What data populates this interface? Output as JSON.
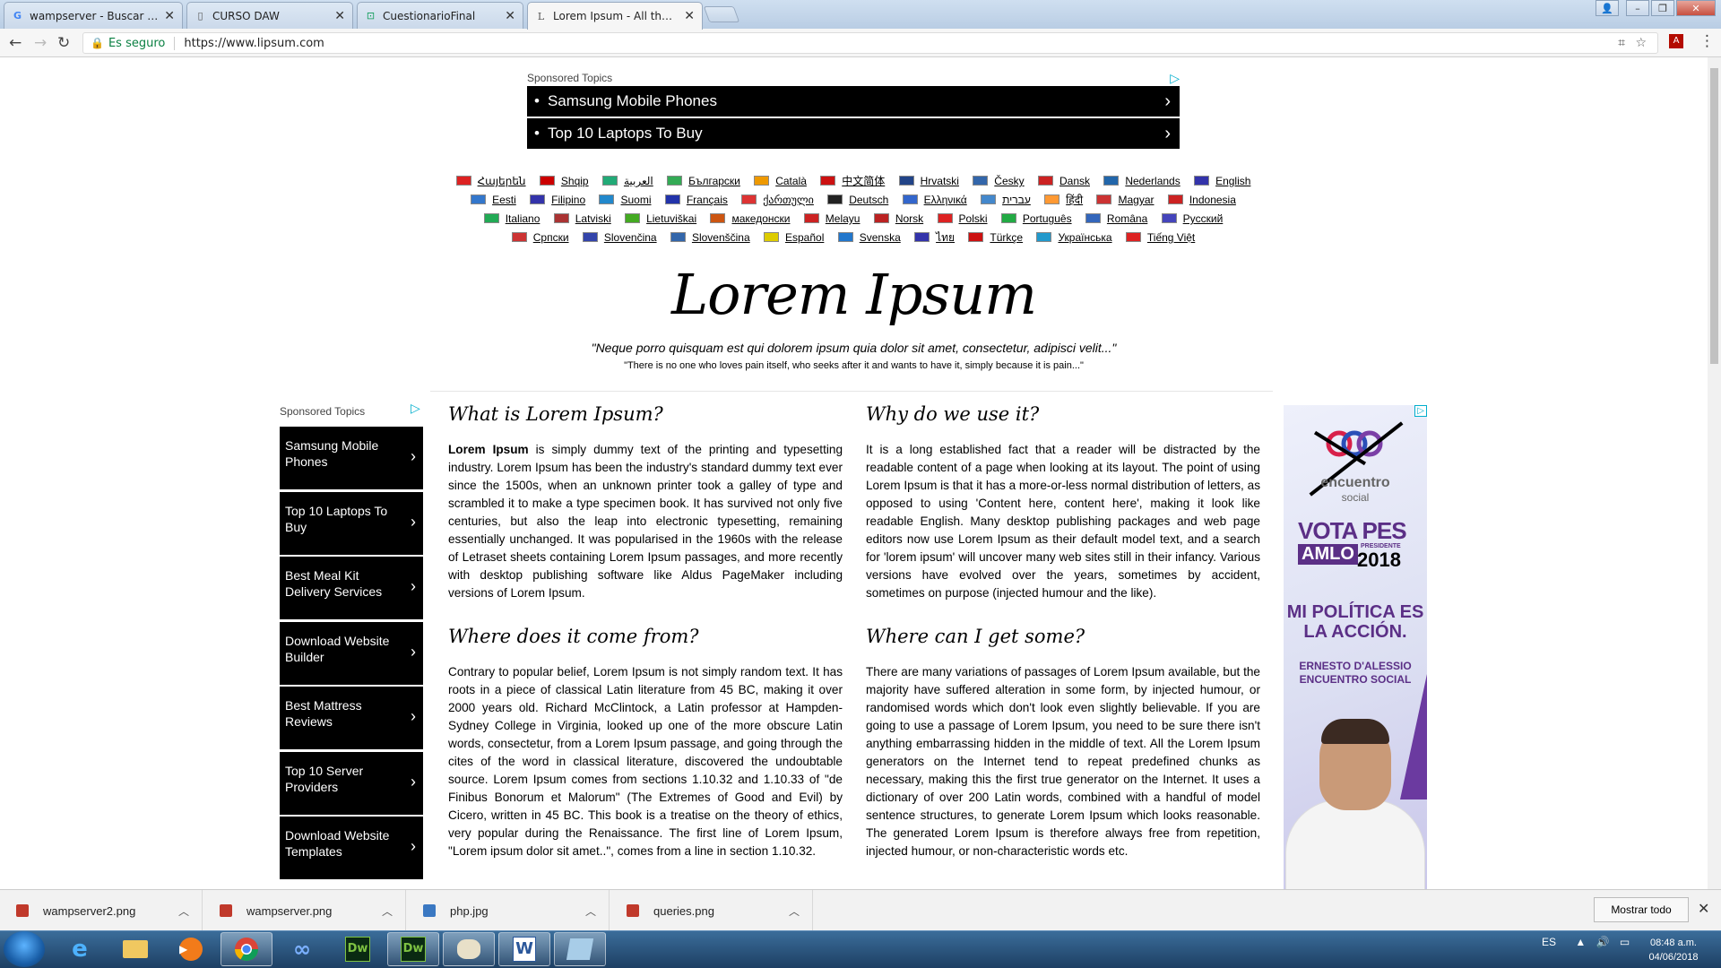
{
  "browser": {
    "tabs": [
      {
        "label": "wampserver - Buscar con",
        "icon": "google-icon"
      },
      {
        "label": "CURSO DAW",
        "icon": "document-icon"
      },
      {
        "label": "CuestionarioFinal",
        "icon": "classroom-icon"
      },
      {
        "label": "Lorem Ipsum - All the fa",
        "icon": "lipsum-icon",
        "active": true
      }
    ],
    "secure_label": "Es seguro",
    "url": "https://www.lipsum.com"
  },
  "page": {
    "top_ad": {
      "label": "Sponsored Topics",
      "items": [
        "Samsung Mobile Phones",
        "Top 10 Laptops To Buy"
      ]
    },
    "languages": [
      "Հայերեն",
      "Shqip",
      "العربية",
      "Български",
      "Català",
      "中文简体",
      "Hrvatski",
      "Česky",
      "Dansk",
      "Nederlands",
      "English",
      "Eesti",
      "Filipino",
      "Suomi",
      "Français",
      "ქართული",
      "Deutsch",
      "Ελληνικά",
      "עברית",
      "हिंदी",
      "Magyar",
      "Indonesia",
      "Italiano",
      "Latviski",
      "Lietuviškai",
      "македонски",
      "Melayu",
      "Norsk",
      "Polski",
      "Português",
      "Româna",
      "Pyccкий",
      "Српски",
      "Slovenčina",
      "Slovenščina",
      "Español",
      "Svenska",
      "ไทย",
      "Türkçe",
      "Українська",
      "Tiếng Việt"
    ],
    "language_colors": [
      "#d22",
      "#c00",
      "#2a7",
      "#3a5",
      "#e90",
      "#c11",
      "#248",
      "#36a",
      "#c22",
      "#26a",
      "#33a",
      "#37c",
      "#33a",
      "#28c",
      "#23a",
      "#d33",
      "#222",
      "#36c",
      "#48c",
      "#f93",
      "#c33",
      "#c22",
      "#2a5",
      "#a33",
      "#4a2",
      "#c51",
      "#c22",
      "#b22",
      "#d22",
      "#2a4",
      "#36b",
      "#44b",
      "#c33",
      "#34a",
      "#36a",
      "#dc0",
      "#27c",
      "#33a",
      "#c11",
      "#29c",
      "#d22"
    ],
    "title": "Lorem Ipsum",
    "quote_latin": "\"Neque porro quisquam est qui dolorem ipsum quia dolor sit amet, consectetur, adipisci velit...\"",
    "quote_english": "\"There is no one who loves pain itself, who seeks after it and wants to have it, simply because it is pain...\"",
    "side_ad": {
      "label": "Sponsored Topics",
      "items": [
        "Samsung Mobile Phones",
        "Top 10 Laptops To Buy",
        "Best Meal Kit Delivery Services",
        "Download Website Builder",
        "Best Mattress Reviews",
        "Top 10 Server Providers",
        "Download Website Templates"
      ]
    },
    "sections": {
      "what": {
        "heading": "What is Lorem Ipsum?",
        "lead": "Lorem Ipsum",
        "body": " is simply dummy text of the printing and typesetting industry. Lorem Ipsum has been the industry's standard dummy text ever since the 1500s, when an unknown printer took a galley of type and scrambled it to make a type specimen book. It has survived not only five centuries, but also the leap into electronic typesetting, remaining essentially unchanged. It was popularised in the 1960s with the release of Letraset sheets containing Lorem Ipsum passages, and more recently with desktop publishing software like Aldus PageMaker including versions of Lorem Ipsum."
      },
      "why": {
        "heading": "Why do we use it?",
        "body": "It is a long established fact that a reader will be distracted by the readable content of a page when looking at its layout. The point of using Lorem Ipsum is that it has a more-or-less normal distribution of letters, as opposed to using 'Content here, content here', making it look like readable English. Many desktop publishing packages and web page editors now use Lorem Ipsum as their default model text, and a search for 'lorem ipsum' will uncover many web sites still in their infancy. Various versions have evolved over the years, sometimes by accident, sometimes on purpose (injected humour and the like)."
      },
      "where_from": {
        "heading": "Where does it come from?",
        "body": "Contrary to popular belief, Lorem Ipsum is not simply random text. It has roots in a piece of classical Latin literature from 45 BC, making it over 2000 years old. Richard McClintock, a Latin professor at Hampden-Sydney College in Virginia, looked up one of the more obscure Latin words, consectetur, from a Lorem Ipsum passage, and going through the cites of the word in classical literature, discovered the undoubtable source. Lorem Ipsum comes from sections 1.10.32 and 1.10.33 of \"de Finibus Bonorum et Malorum\" (The Extremes of Good and Evil) by Cicero, written in 45 BC. This book is a treatise on the theory of ethics, very popular during the Renaissance. The first line of Lorem Ipsum, \"Lorem ipsum dolor sit amet..\", comes from a line in section 1.10.32."
      },
      "where_get": {
        "heading": "Where can I get some?",
        "body": "There are many variations of passages of Lorem Ipsum available, but the majority have suffered alteration in some form, by injected humour, or randomised words which don't look even slightly believable. If you are going to use a passage of Lorem Ipsum, you need to be sure there isn't anything embarrassing hidden in the middle of text. All the Lorem Ipsum generators on the Internet tend to repeat predefined chunks as necessary, making this the first true generator on the Internet. It uses a dictionary of over 200 Latin words, combined with a handful of model sentence structures, to generate Lorem Ipsum which looks reasonable. The generated Lorem Ipsum is therefore always free from repetition, injected humour, or non-characteristic words etc."
      }
    },
    "right_ad": {
      "brand": "encuentro",
      "brand_sub": "social",
      "vote": "VOTA PES",
      "candidate": "AMLO",
      "office": "PRESIDENTE",
      "year": "2018",
      "slogan": "MI POLÍTICA ES LA ACCIÓN.",
      "person": "ERNESTO D'ALESSIO",
      "party": "ENCUENTRO SOCIAL"
    }
  },
  "downloads": {
    "items": [
      {
        "name": "wampserver2.png",
        "type": "png"
      },
      {
        "name": "wampserver.png",
        "type": "png"
      },
      {
        "name": "php.jpg",
        "type": "jpg"
      },
      {
        "name": "queries.png",
        "type": "png"
      }
    ],
    "show_all": "Mostrar todo"
  },
  "taskbar": {
    "lang": "ES",
    "time": "08:48 a.m.",
    "date": "04/06/2018"
  }
}
